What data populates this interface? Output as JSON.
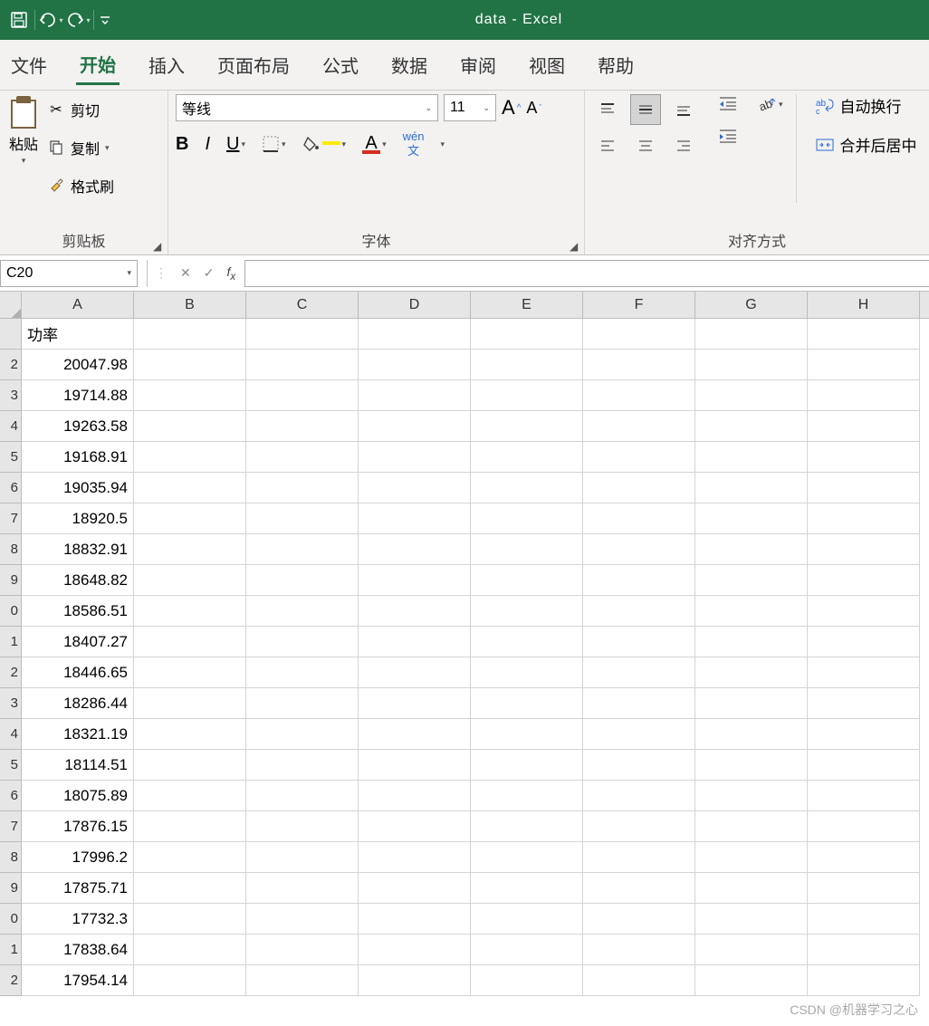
{
  "title": "data  -  Excel",
  "tabs": [
    "文件",
    "开始",
    "插入",
    "页面布局",
    "公式",
    "数据",
    "审阅",
    "视图",
    "帮助"
  ],
  "active_tab": "开始",
  "clipboard": {
    "paste": "粘贴",
    "cut": "剪切",
    "copy": "复制",
    "format_painter": "格式刷",
    "group": "剪贴板"
  },
  "font": {
    "name": "等线",
    "size": "11",
    "phonetic": "wén",
    "phonetic2": "文",
    "group": "字体"
  },
  "alignment": {
    "wrap": "自动换行",
    "merge": "合并后居中",
    "group": "对齐方式"
  },
  "name_box": "C20",
  "columns": [
    "A",
    "B",
    "C",
    "D",
    "E",
    "F",
    "G",
    "H"
  ],
  "row_header_numbers": [
    "",
    "2",
    "3",
    "4",
    "5",
    "6",
    "7",
    "8",
    "9",
    "0",
    "1",
    "2",
    "3",
    "4",
    "5",
    "6",
    "7",
    "8",
    "9",
    "0",
    "1",
    "2"
  ],
  "data": {
    "header": "功率",
    "values": [
      "20047.98",
      "19714.88",
      "19263.58",
      "19168.91",
      "19035.94",
      "18920.5",
      "18832.91",
      "18648.82",
      "18586.51",
      "18407.27",
      "18446.65",
      "18286.44",
      "18321.19",
      "18114.51",
      "18075.89",
      "17876.15",
      "17996.2",
      "17875.71",
      "17732.3",
      "17838.64",
      "17954.14"
    ]
  },
  "watermark": "CSDN @机器学习之心"
}
